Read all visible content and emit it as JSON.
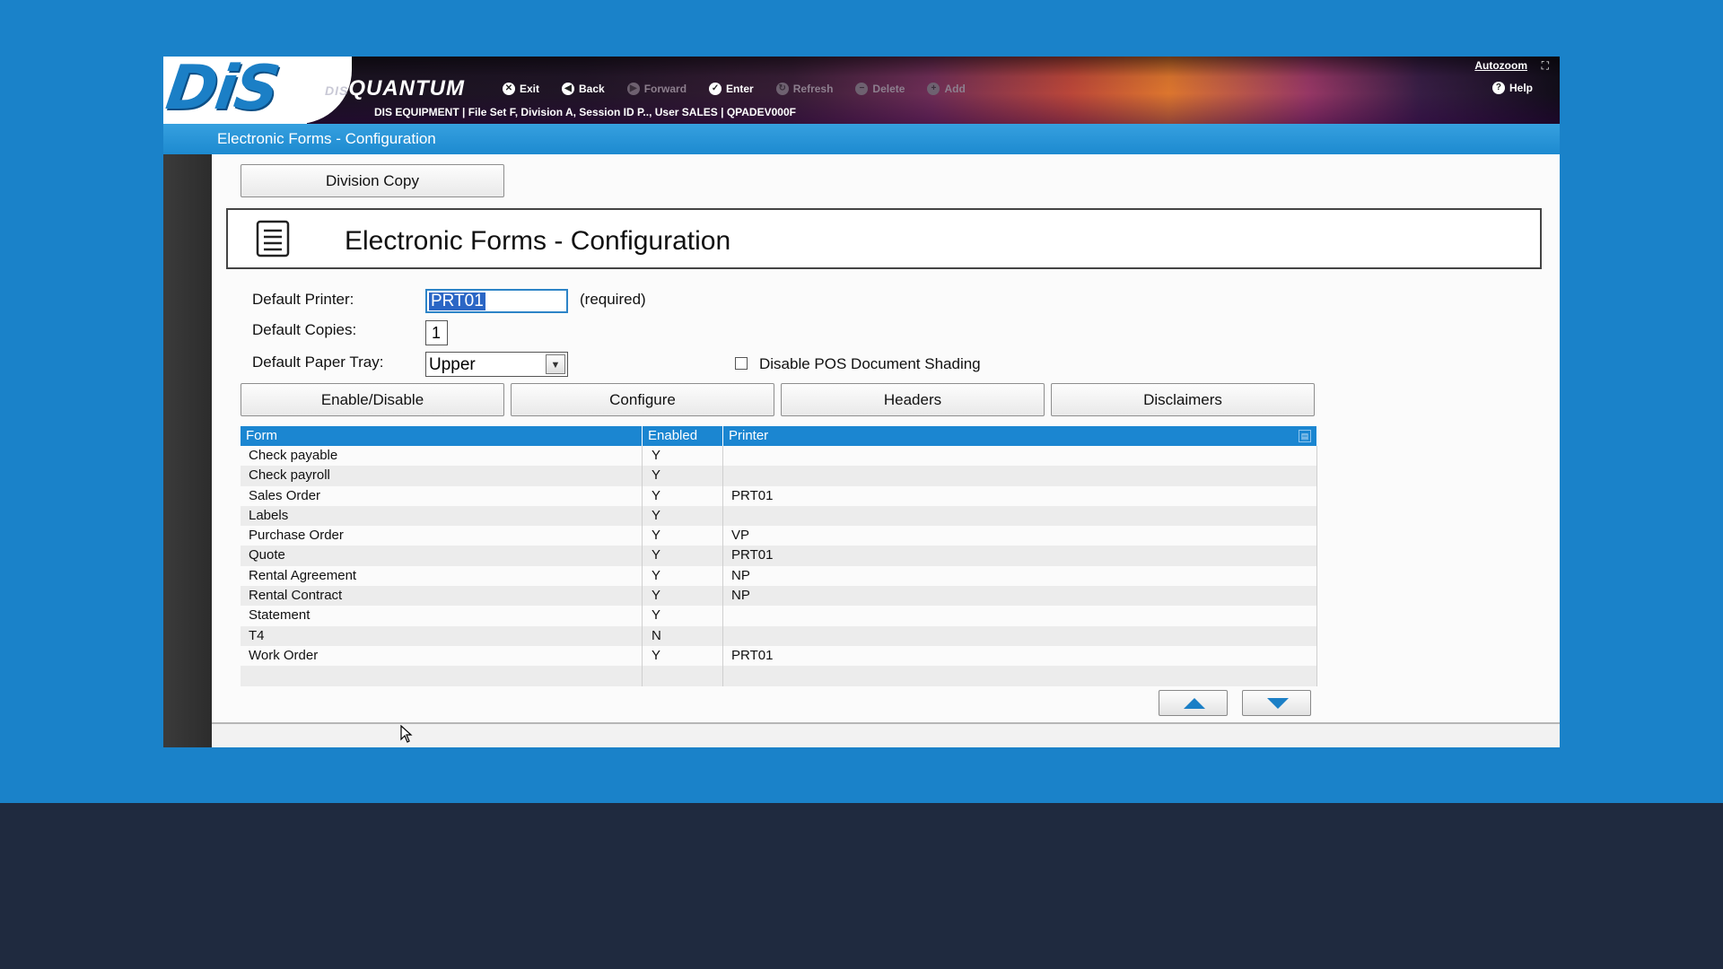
{
  "app": {
    "brand_small": "DIS",
    "brand_big": "QUANTUM",
    "logo": "DiS",
    "session_info": "DIS EQUIPMENT | File Set F, Division A, Session ID P.., User SALES | QPADEV000F",
    "autozoom_label": "Autozoom",
    "help_label": "Help"
  },
  "toolbar": {
    "exit": "Exit",
    "back": "Back",
    "forward": "Forward",
    "enter": "Enter",
    "refresh": "Refresh",
    "delete": "Delete",
    "add": "Add"
  },
  "titlebar": {
    "title": "Electronic Forms - Configuration"
  },
  "content": {
    "division_copy_label": "Division Copy",
    "page_title": "Electronic Forms - Configuration",
    "default_printer_label": "Default Printer:",
    "default_printer_value": "PRT01",
    "required_label": "(required)",
    "default_copies_label": "Default Copies:",
    "default_copies_value": "1",
    "default_tray_label": "Default Paper Tray:",
    "default_tray_value": "Upper",
    "shading_label": "Disable POS Document Shading",
    "shading_checked": false
  },
  "actions": {
    "enable_disable": "Enable/Disable",
    "configure": "Configure",
    "headers": "Headers",
    "disclaimers": "Disclaimers"
  },
  "grid": {
    "headers": {
      "form": "Form",
      "enabled": "Enabled",
      "printer": "Printer"
    },
    "rows": [
      {
        "form": "Check payable",
        "enabled": "Y",
        "printer": ""
      },
      {
        "form": "Check payroll",
        "enabled": "Y",
        "printer": ""
      },
      {
        "form": "Sales Order",
        "enabled": "Y",
        "printer": "PRT01"
      },
      {
        "form": "Labels",
        "enabled": "Y",
        "printer": ""
      },
      {
        "form": "Purchase Order",
        "enabled": "Y",
        "printer": "VP"
      },
      {
        "form": "Quote",
        "enabled": "Y",
        "printer": "PRT01"
      },
      {
        "form": "Rental Agreement",
        "enabled": "Y",
        "printer": "NP"
      },
      {
        "form": "Rental Contract",
        "enabled": "Y",
        "printer": "NP"
      },
      {
        "form": "Statement",
        "enabled": "Y",
        "printer": ""
      },
      {
        "form": "T4",
        "enabled": "N",
        "printer": ""
      },
      {
        "form": "Work Order",
        "enabled": "Y",
        "printer": "PRT01"
      },
      {
        "form": "",
        "enabled": "",
        "printer": ""
      }
    ]
  },
  "colors": {
    "accent": "#1b86d1",
    "background": "#1a82c9",
    "bottom_band": "#1f2a3f"
  }
}
